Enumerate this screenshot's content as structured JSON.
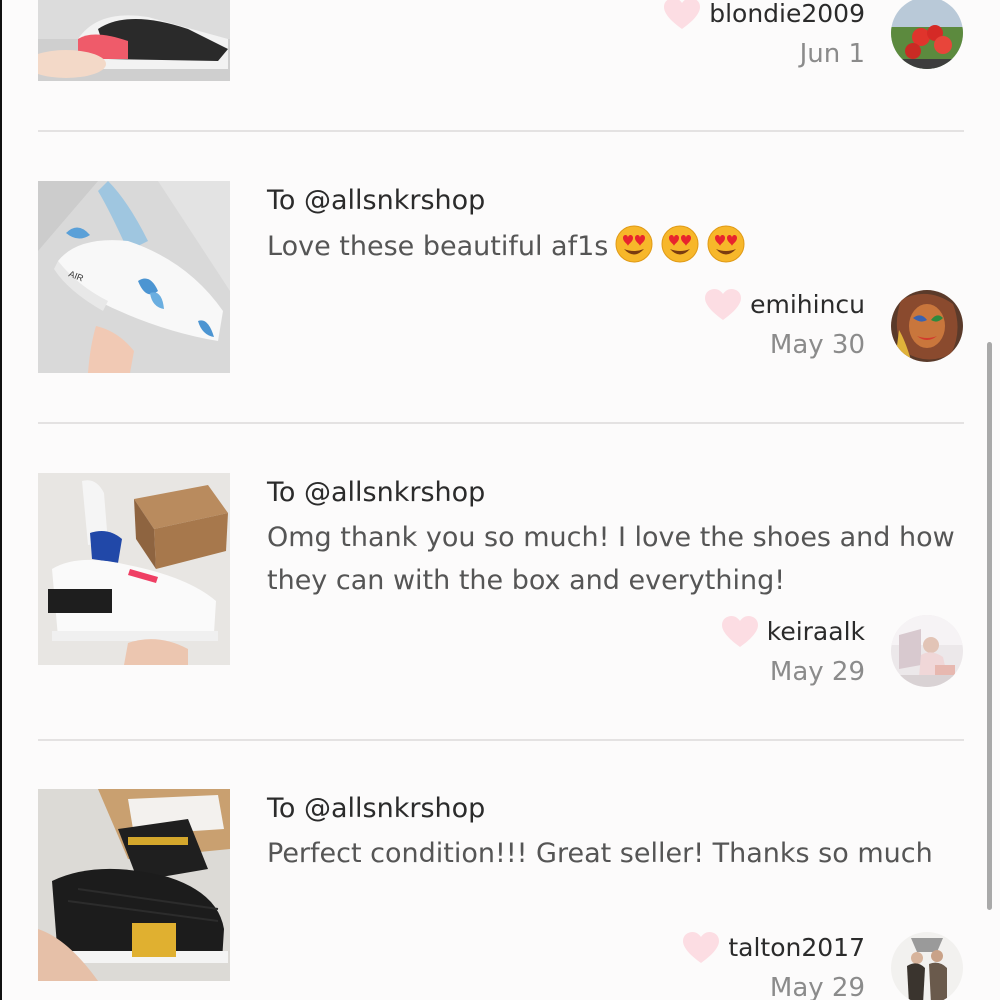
{
  "reviews": [
    {
      "to": "",
      "message": "",
      "username": "blondie2009",
      "date": "Jun 1",
      "liked": false
    },
    {
      "to": "To @allsnkrshop",
      "message": "Love these beautiful af1s",
      "emojis": [
        "heart-eyes",
        "heart-eyes",
        "heart-eyes"
      ],
      "username": "emihincu",
      "date": "May 30",
      "liked": false
    },
    {
      "to": "To @allsnkrshop",
      "message": "Omg thank you so much! I love the shoes and how they can with the box and everything!",
      "username": "keiraalk",
      "date": "May 29",
      "liked": false
    },
    {
      "to": "To @allsnkrshop",
      "message": "Perfect condition!!! Great seller! Thanks so much",
      "username": "talton2017",
      "date": "May 29",
      "liked": false
    }
  ],
  "icons": {
    "like": "heart-icon",
    "reaction": "heart-eyes-emoji"
  },
  "colors": {
    "heart": "#fcdde3",
    "divider": "#e4e2e2",
    "text_primary": "#2b2b2b",
    "text_secondary": "#555555",
    "date": "#8b8b8b"
  }
}
